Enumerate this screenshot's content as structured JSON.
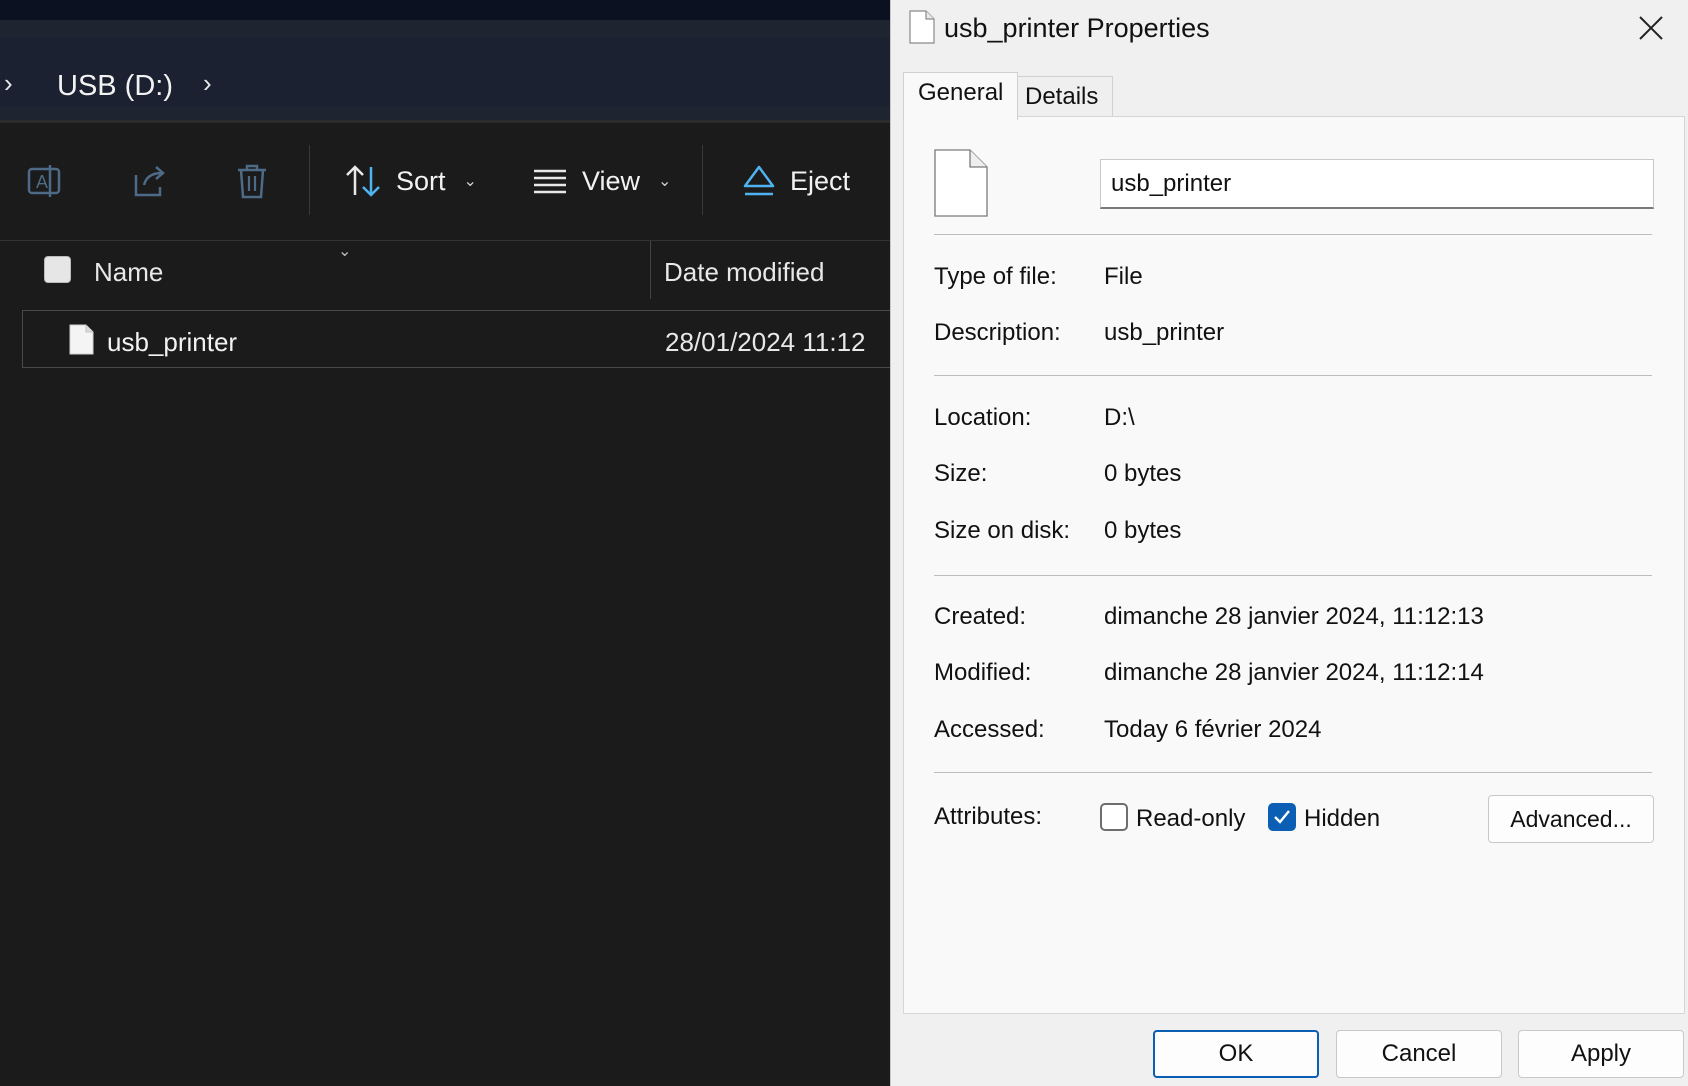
{
  "explorer": {
    "breadcrumb": {
      "current": "USB (D:)"
    },
    "toolbar": {
      "sort_label": "Sort",
      "view_label": "View",
      "eject_label": "Eject"
    },
    "columns": {
      "name": "Name",
      "date_modified": "Date modified"
    },
    "files": [
      {
        "name": "usb_printer",
        "date_modified": "28/01/2024 11:12"
      }
    ]
  },
  "dialog": {
    "title": "usb_printer Properties",
    "tabs": [
      {
        "label": "General",
        "active": true
      },
      {
        "label": "Details",
        "active": false
      }
    ],
    "file_name": "usb_printer",
    "props": {
      "type": {
        "label": "Type of file:",
        "value": "File"
      },
      "description": {
        "label": "Description:",
        "value": "usb_printer"
      },
      "location": {
        "label": "Location:",
        "value": "D:\\"
      },
      "size": {
        "label": "Size:",
        "value": "0 bytes"
      },
      "size_on_disk": {
        "label": "Size on disk:",
        "value": "0 bytes"
      },
      "created": {
        "label": "Created:",
        "value": "dimanche 28 janvier 2024, 11:12:13"
      },
      "modified": {
        "label": "Modified:",
        "value": "dimanche 28 janvier 2024, 11:12:14"
      },
      "accessed": {
        "label": "Accessed:",
        "value": "Today 6 février 2024"
      }
    },
    "attributes": {
      "label": "Attributes:",
      "readonly_label": "Read-only",
      "readonly_checked": false,
      "hidden_label": "Hidden",
      "hidden_checked": true,
      "advanced_label": "Advanced..."
    },
    "buttons": {
      "ok": "OK",
      "cancel": "Cancel",
      "apply": "Apply"
    }
  },
  "colors": {
    "accent": "#0a5fb4",
    "explorer_bg": "#1b1b1b",
    "dialog_bg": "#f0f0f0",
    "eject_icon": "#4fb3f0"
  }
}
